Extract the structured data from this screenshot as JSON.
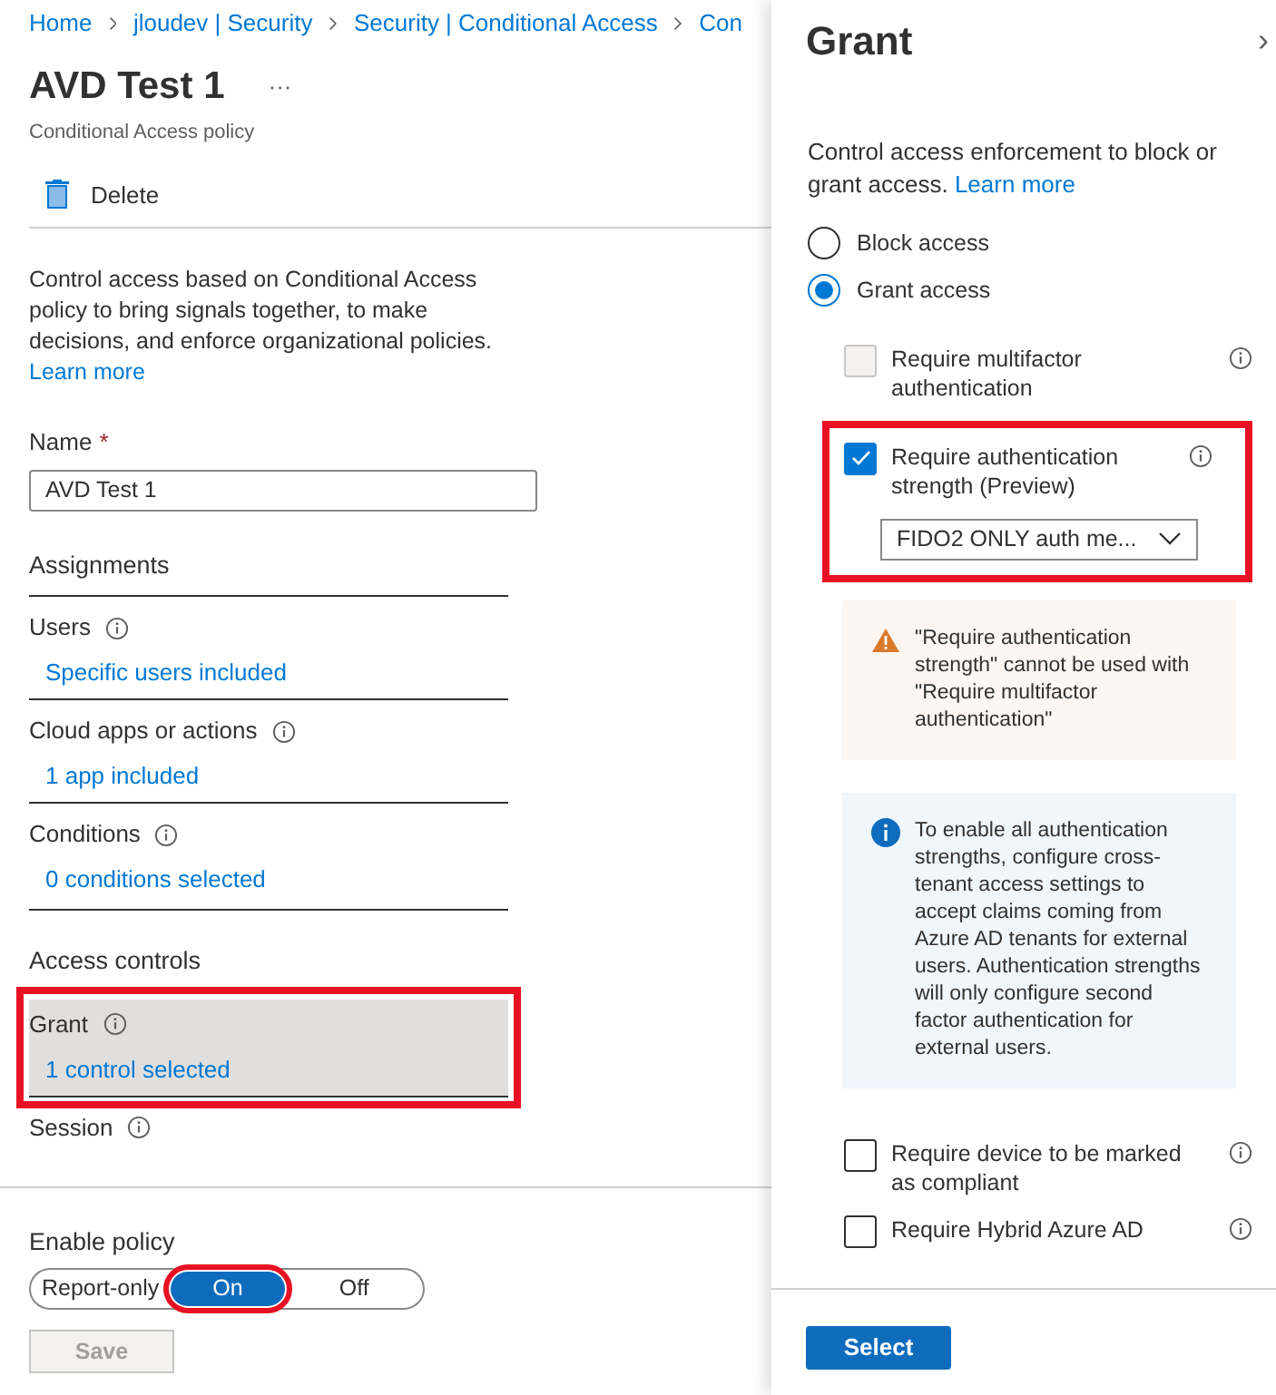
{
  "breadcrumb": [
    "Home",
    "jloudev | Security",
    "Security | Conditional Access",
    "Con"
  ],
  "title": "AVD Test 1",
  "more": "···",
  "subtitle": "Conditional Access policy",
  "toolbar": {
    "delete": "Delete"
  },
  "description": "Control access based on Conditional Access policy to bring signals together, to make decisions, and enforce organizational policies.",
  "learn_more": "Learn more",
  "name_field": {
    "label": "Name",
    "required_mark": "*",
    "value": "AVD Test 1"
  },
  "assignments": {
    "heading": "Assignments",
    "items": [
      {
        "label": "Users",
        "link": "Specific users included"
      },
      {
        "label": "Cloud apps or actions",
        "link": "1 app included"
      },
      {
        "label": "Conditions",
        "link": "0 conditions selected"
      }
    ]
  },
  "access_controls": {
    "heading": "Access controls",
    "items": [
      {
        "label": "Grant",
        "link": "1 control selected",
        "highlighted": true,
        "selected": true
      },
      {
        "label": "Session",
        "highlighted": false,
        "selected": false
      }
    ]
  },
  "enable_policy": {
    "label": "Enable policy",
    "options": [
      {
        "label": "Report-only",
        "selected": false,
        "highlighted": false
      },
      {
        "label": "On",
        "selected": true,
        "highlighted": true
      },
      {
        "label": "Off",
        "selected": false,
        "highlighted": false
      }
    ]
  },
  "save": {
    "label": "Save",
    "disabled": true
  },
  "panel": {
    "title": "Grant",
    "close": "›",
    "description": "Control access enforcement to block or grant access.",
    "learn_more": "Learn more",
    "radios": [
      {
        "label": "Block access",
        "selected": false
      },
      {
        "label": "Grant access",
        "selected": true
      }
    ],
    "controls": [
      {
        "kind": "checkbox",
        "label": "Require multifactor authentication",
        "checked": false,
        "disabled": true,
        "highlighted": false
      },
      {
        "kind": "checkbox",
        "label": "Require authentication strength (Preview)",
        "checked": true,
        "disabled": false,
        "highlighted": true,
        "dropdown": "FIDO2 ONLY auth me..."
      },
      {
        "kind": "warning",
        "text": "\"Require authentication strength\" cannot be used with \"Require multifactor authentication\""
      },
      {
        "kind": "info",
        "text": "To enable all authentication strengths, configure cross-tenant access settings to accept claims coming from Azure AD tenants for external users. Authentication strengths will only configure second factor authentication for external users."
      },
      {
        "kind": "checkbox",
        "label": "Require device to be marked as compliant",
        "checked": false,
        "disabled": false,
        "highlighted": false
      },
      {
        "kind": "checkbox",
        "label": "Require Hybrid Azure AD",
        "checked": false,
        "disabled": false,
        "highlighted": false
      }
    ],
    "select": "Select"
  }
}
